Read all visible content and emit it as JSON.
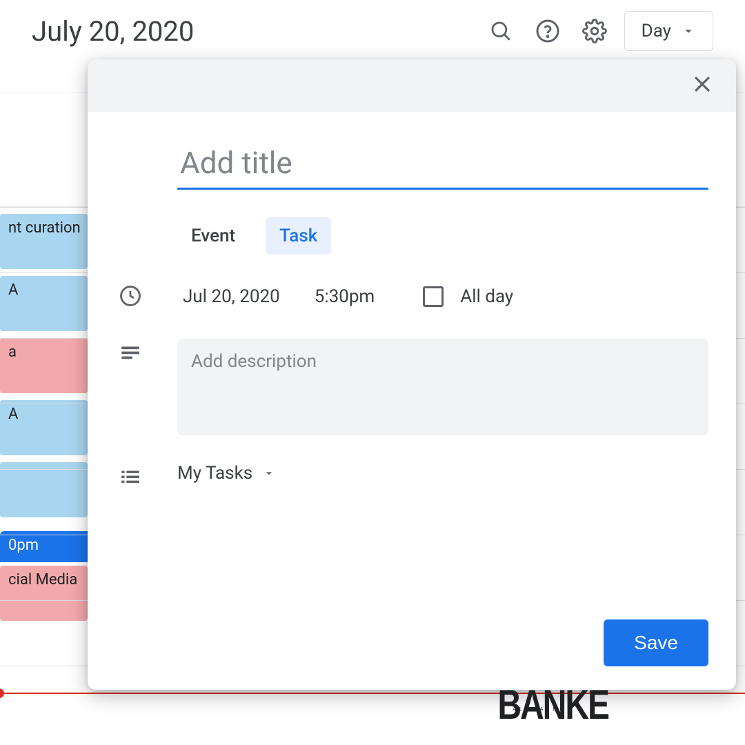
{
  "header": {
    "date": "July 20, 2020",
    "view_button": "Day"
  },
  "background_events": {
    "ev1": "nt curation",
    "ev2": "A",
    "ev3": "a",
    "ev4": "A",
    "ev6": "0pm",
    "ev7": "cial Media"
  },
  "dialog": {
    "title_placeholder": "Add title",
    "tabs": {
      "event": "Event",
      "task": "Task"
    },
    "date": "Jul 20, 2020",
    "time": "5:30pm",
    "all_day": "All day",
    "description_placeholder": "Add description",
    "task_list": "My Tasks",
    "save": "Save"
  },
  "brand": {
    "main": "BANKE",
    "sub": "ALAWAYE"
  }
}
